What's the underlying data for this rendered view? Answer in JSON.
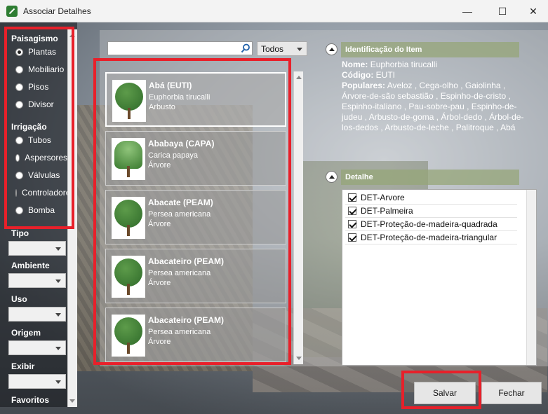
{
  "window": {
    "title": "Associar Detalhes",
    "minimize": "—",
    "maximize": "☐",
    "close": "✕"
  },
  "sidebar": {
    "paisagismo_label": "Paisagismo",
    "paisagismo_options": [
      "Plantas",
      "Mobiliario",
      "Pisos",
      "Divisor"
    ],
    "irrigacao_label": "Irrigação",
    "irrigacao_options": [
      "Tubos",
      "Aspersores",
      "Válvulas",
      "Controladores",
      "Bomba"
    ],
    "filters": [
      "Tipo",
      "Ambiente",
      "Uso",
      "Origem",
      "Exibir",
      "Favoritos"
    ]
  },
  "search": {
    "placeholder": "",
    "filter_value": "Todos"
  },
  "items": [
    {
      "name": "Abá (EUTI)",
      "scientific": "Euphorbia tirucalli",
      "kind": "Arbusto",
      "icon": "shrub-thumbnail"
    },
    {
      "name": "Ababaya (CAPA)",
      "scientific": "Carica papaya",
      "kind": "Árvore",
      "icon": "papaya-thumbnail"
    },
    {
      "name": "Abacate (PEAM)",
      "scientific": "Persea americana",
      "kind": "Árvore",
      "icon": "tree-thumbnail"
    },
    {
      "name": "Abacateiro (PEAM)",
      "scientific": "Persea americana",
      "kind": "Árvore",
      "icon": "tree-thumbnail"
    },
    {
      "name": "Abacateiro (PEAM)",
      "scientific": "Persea americana",
      "kind": "Árvore",
      "icon": "tree-thumbnail"
    }
  ],
  "identificacao": {
    "header": "Identificação do Item",
    "nome_label": "Nome:",
    "nome_value": "Euphorbia tirucalli",
    "codigo_label": "Código:",
    "codigo_value": "EUTI",
    "populares_label": "Populares:",
    "populares_value": "Aveloz , Cega-olho , Gaiolinha , Árvore-de-são sebastião , Espinho-de-cristo , Espinho-italiano , Pau-sobre-pau , Espinho-de-judeu , Arbusto-de-goma , Árbol-dedo , Árbol-de-los-dedos , Arbusto-de-leche , Palitroque , Abá"
  },
  "detalhe": {
    "header": "Detalhe",
    "rows": [
      "DET-Arvore",
      "DET-Palmeira",
      "DET-Proteção-de-madeira-quadrada",
      "DET-Proteção-de-madeira-triangular"
    ]
  },
  "buttons": {
    "salvar": "Salvar",
    "fechar": "Fechar"
  },
  "colors": {
    "highlight": "#e8202a",
    "header_bar": "#96a578"
  }
}
